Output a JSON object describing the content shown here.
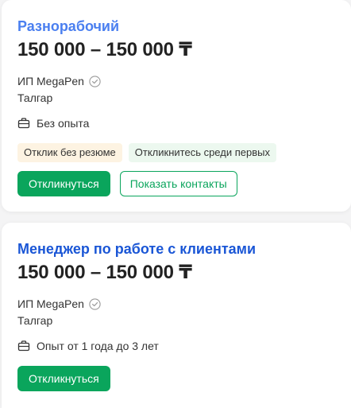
{
  "colors": {
    "title_light": "#4a7ff0",
    "title_dark": "#1a56d6",
    "accent_green": "#0aa55c",
    "tag_warm": "#fdf3e2",
    "tag_green": "#ecf8ef"
  },
  "vacancies": [
    {
      "title": "Разнорабочий",
      "salary": "150 000 – 150 000 ₸",
      "company": "ИП MegaPen",
      "company_icon": "verified-check-icon",
      "city": "Талгар",
      "experience_icon": "briefcase-icon",
      "experience": "Без опыта",
      "tags": [
        "Отклик без резюме",
        "Откликнитесь среди первых"
      ],
      "respond_label": "Откликнуться",
      "contacts_label": "Показать контакты"
    },
    {
      "title": "Менеджер по работе с клиентами",
      "salary": "150 000 – 150 000 ₸",
      "company": "ИП MegaPen",
      "company_icon": "verified-check-icon",
      "city": "Талгар",
      "experience_icon": "briefcase-icon",
      "experience": "Опыт от 1 года до 3 лет",
      "respond_label": "Откликнуться"
    }
  ]
}
